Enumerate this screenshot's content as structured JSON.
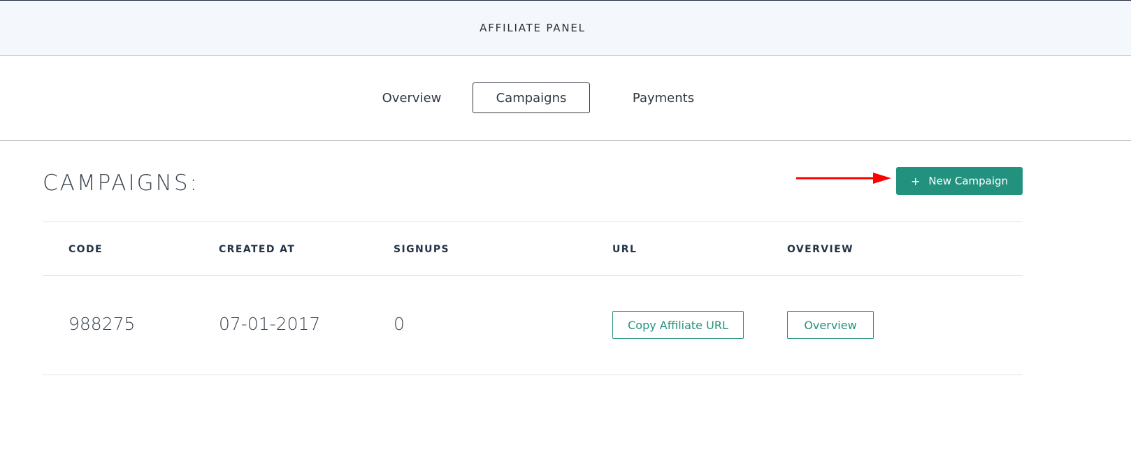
{
  "header": {
    "title": "AFFILIATE PANEL"
  },
  "tabs": [
    {
      "label": "Overview"
    },
    {
      "label": "Campaigns"
    },
    {
      "label": "Payments"
    }
  ],
  "active_tab": "Campaigns",
  "section": {
    "title": "CAMPAIGNS:",
    "new_button": {
      "icon": "plus-icon",
      "label": "New Campaign"
    },
    "annotation": {
      "icon": "red-arrow-icon",
      "color": "#ff0000"
    }
  },
  "table": {
    "columns": [
      "CODE",
      "CREATED AT",
      "SIGNUPS",
      "URL",
      "OVERVIEW"
    ],
    "rows": [
      {
        "code": "988275",
        "created_at": "07-01-2017",
        "signups": "0",
        "url_button": "Copy Affiliate URL",
        "overview_button": "Overview"
      }
    ]
  },
  "colors": {
    "accent": "#22917e",
    "header_bg": "#f4f8fd",
    "text": "#2b3440"
  }
}
